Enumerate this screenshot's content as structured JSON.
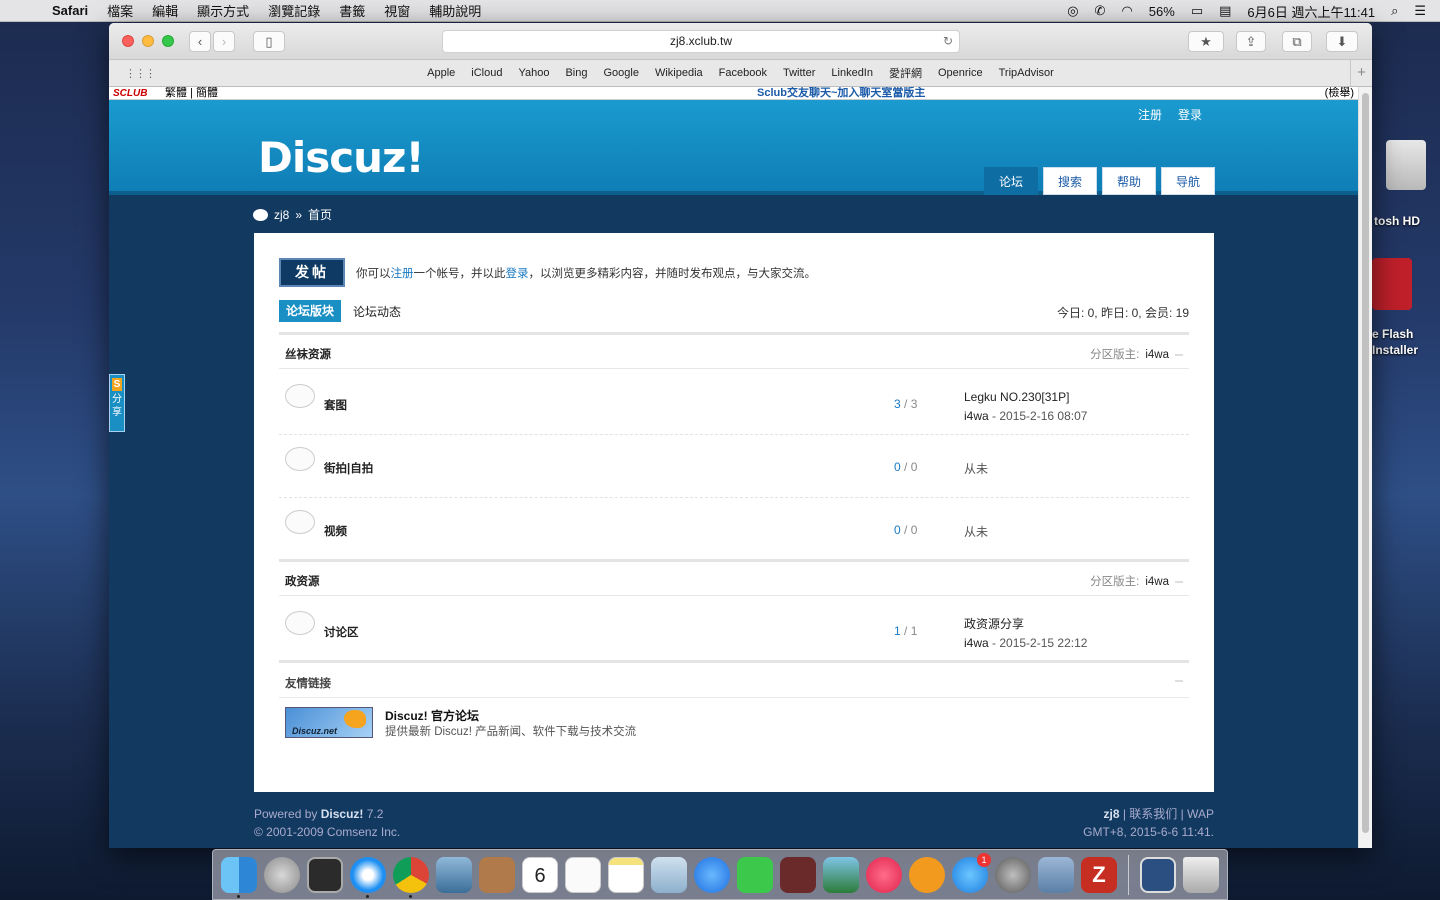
{
  "menubar": {
    "app": "Safari",
    "items": [
      "檔案",
      "編輯",
      "顯示方式",
      "瀏覽記錄",
      "書籤",
      "視窗",
      "輔助說明"
    ],
    "battery": "56%",
    "clock": "6月6日 週六上午11:41"
  },
  "desktop": {
    "hd_label": "tosh HD",
    "flash_label_1": "e Flash",
    "flash_label_2": "Installer"
  },
  "browser": {
    "address": "zj8.xclub.tw",
    "favorites": [
      "Apple",
      "iCloud",
      "Yahoo",
      "Bing",
      "Google",
      "Wikipedia",
      "Facebook",
      "Twitter",
      "LinkedIn",
      "愛評網",
      "Openrice",
      "TripAdvisor"
    ]
  },
  "sclub": {
    "logo": "SCLUB",
    "lang": "繁體 | 簡體",
    "promo": "Sclub交友聊天~加入聊天室當版主",
    "report": "(檢舉)"
  },
  "header": {
    "logo": "Discuz!",
    "register": "注册",
    "login": "登录",
    "nav": [
      "论坛",
      "搜索",
      "帮助",
      "导航"
    ]
  },
  "breadcrumb": {
    "site": "zj8",
    "sep": "»",
    "page": "首页"
  },
  "share": {
    "label_top": "分",
    "label_bottom": "享"
  },
  "main": {
    "post_button": "发帖",
    "intro_before": "你可以",
    "intro_register": "注册",
    "intro_mid": "一个帐号，并以此",
    "intro_login": "登录",
    "intro_after": "，以浏览更多精彩内容，并随时发布观点，与大家交流。",
    "tab_active": "论坛版块",
    "tab_other": "论坛动态",
    "stats": "今日: 0, 昨日: 0, 会员: 19",
    "moderator_label": "分区版主:",
    "sections": [
      {
        "name": "丝袜资源",
        "moderator": "i4wa",
        "forums": [
          {
            "name": "套图",
            "threads": "3",
            "posts": "3",
            "last_title": "Legku NO.230[31P]",
            "last_user": "i4wa",
            "last_time": "2015-2-16 08:07"
          },
          {
            "name": "街拍|自拍",
            "threads": "0",
            "posts": "0",
            "last_single": "从未"
          },
          {
            "name": "视频",
            "threads": "0",
            "posts": "0",
            "last_single": "从未"
          }
        ]
      },
      {
        "name": "政资源",
        "moderator": "i4wa",
        "forums": [
          {
            "name": "讨论区",
            "threads": "1",
            "posts": "1",
            "last_title": "政资源分享",
            "last_user": "i4wa",
            "last_time": "2015-2-15 22:12"
          }
        ]
      }
    ],
    "friends_title": "友情链接",
    "friend": {
      "badge": "Discuz.net",
      "title": "Discuz! 官方论坛",
      "desc": "提供最新 Discuz! 产品新闻、软件下载与技术交流"
    }
  },
  "footer": {
    "powered": "Powered by",
    "product": "Discuz!",
    "version": "7.2",
    "copyright": "© 2001-2009 Comsenz Inc.",
    "site": "zj8",
    "contact": "联系我们",
    "wap": "WAP",
    "time": "GMT+8, 2015-6-6 11:41."
  },
  "dock": {
    "calendar_day": "6",
    "appstore_badge": "1"
  }
}
